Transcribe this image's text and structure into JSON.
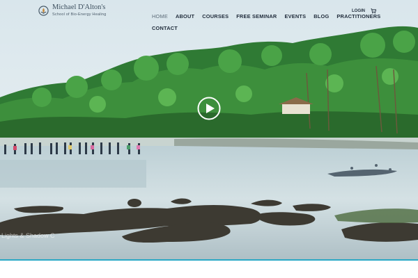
{
  "brand": {
    "name": "Michael D'Alton's",
    "tagline": "School of Bio-Energy Healing",
    "logo_icon": "lotus-logo-icon"
  },
  "nav": {
    "items": [
      {
        "label": "HOME",
        "active": true
      },
      {
        "label": "ABOUT"
      },
      {
        "label": "COURSES"
      },
      {
        "label": "FREE SEMINAR"
      },
      {
        "label": "EVENTS"
      },
      {
        "label": "BLOG"
      },
      {
        "label": "PRACTITIONERS"
      },
      {
        "label": "CONTACT"
      }
    ]
  },
  "util": {
    "login_label": "LOGIN",
    "cart_icon": "cart-icon"
  },
  "hero": {
    "play_icon": "play-icon",
    "watermark": "Lights & Shadow C"
  },
  "colors": {
    "accent_bar": "#2aa9c6",
    "nav_text": "#1f2b3a",
    "nav_active": "#5b6b77"
  }
}
